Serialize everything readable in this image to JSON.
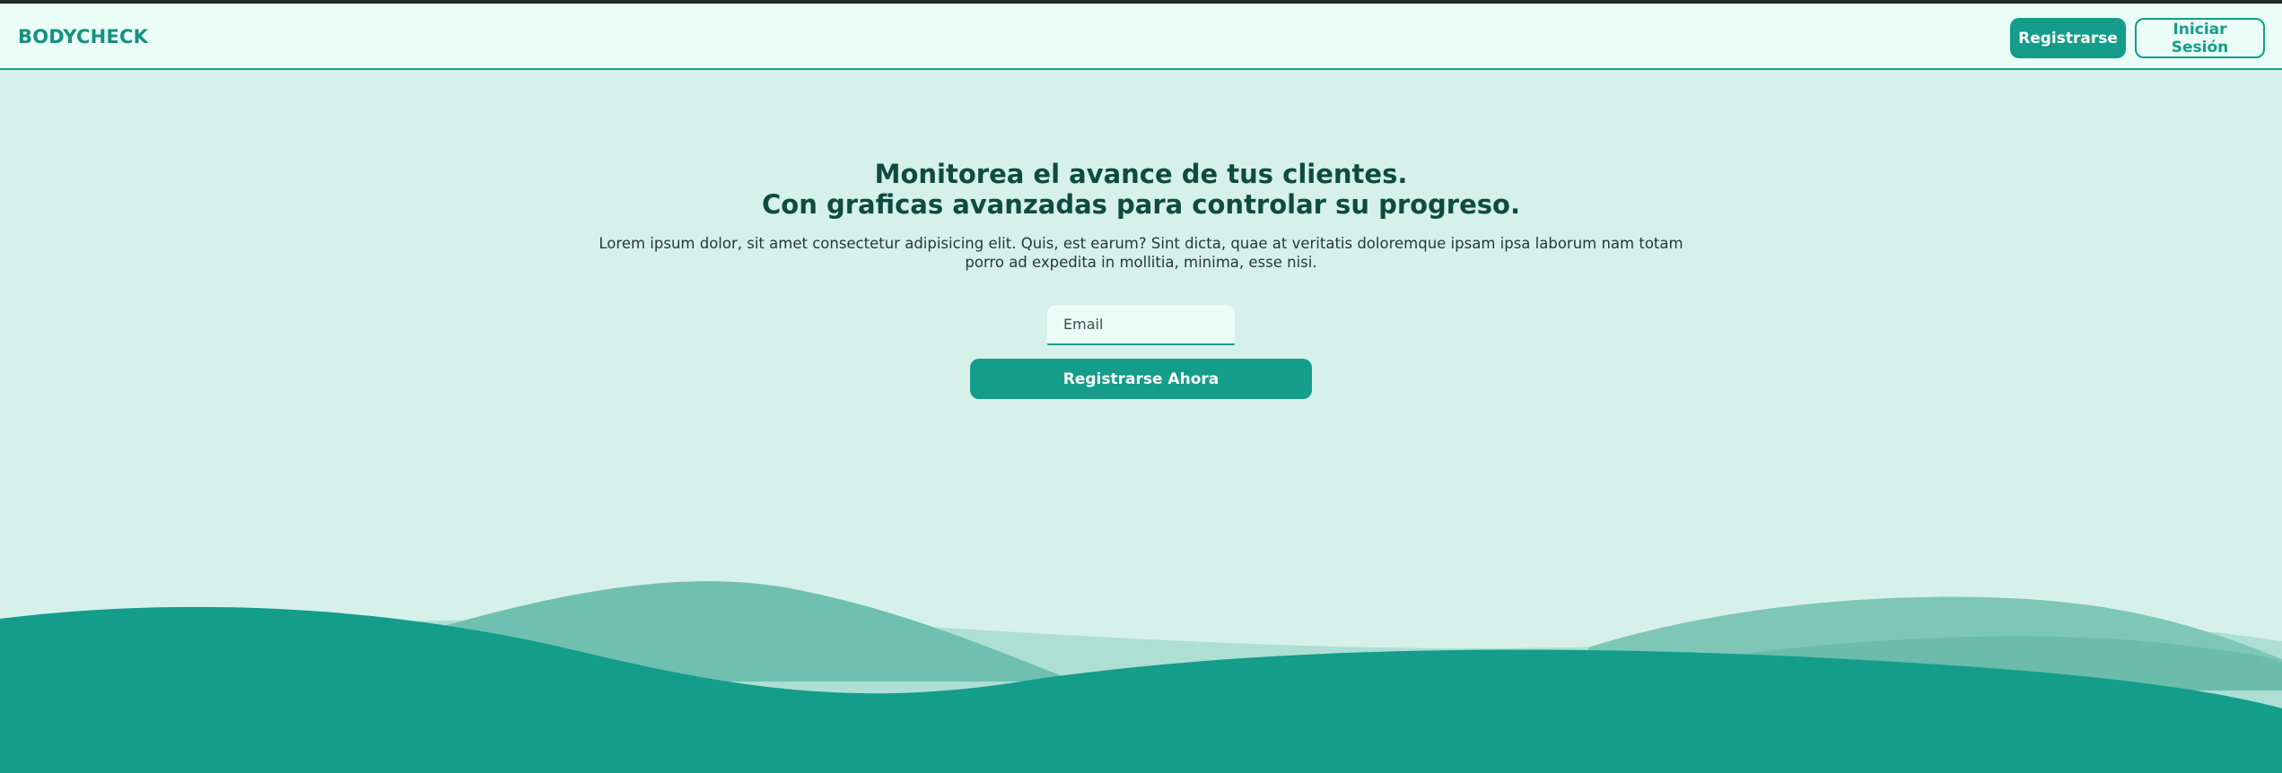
{
  "header": {
    "brand": "BODYCHECK",
    "register_label": "Registrarse",
    "login_label": "Iniciar Sesión"
  },
  "hero": {
    "title_line1": "Monitorea el avance de tus clientes.",
    "title_line2": "Con graficas avanzadas para controlar su progreso.",
    "description": "Lorem ipsum dolor, sit amet consectetur adipisicing elit. Quis, est earum? Sint dicta, quae at veritatis doloremque ipsam ipsa laborum nam totam porro ad expedita in mollitia, minima, esse nisi.",
    "email_placeholder": "Email",
    "cta_label": "Registrarse Ahora"
  },
  "colors": {
    "primary": "#139d8a",
    "background": "#d6f1ea",
    "navbar": "#eafdf7",
    "heading": "#0e4b40"
  }
}
